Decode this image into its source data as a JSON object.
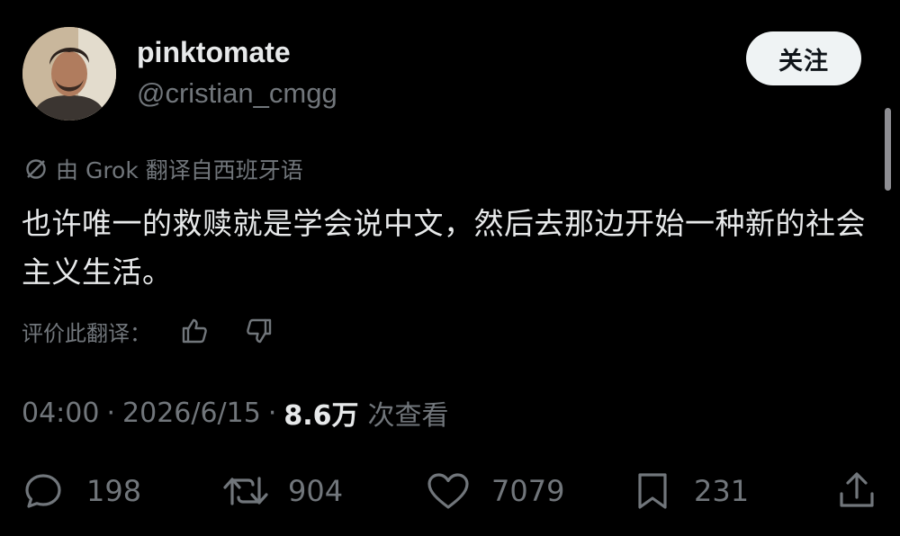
{
  "author": {
    "display_name": "pinktomate",
    "handle": "@cristian_cmgg"
  },
  "follow_button": {
    "label": "关注"
  },
  "translation": {
    "note": "由 Grok 翻译自西班牙语",
    "rate_label": "评价此翻译："
  },
  "tweet": {
    "text": "也许唯一的救赎就是学会说中文，然后去那边开始一种新的社会主义生活。"
  },
  "meta": {
    "time": "04:00",
    "date": "2026/6/15",
    "separator": "·",
    "views_count": "8.6万",
    "views_label": "次查看"
  },
  "actions": {
    "replies": "198",
    "reposts": "904",
    "likes": "7079",
    "bookmarks": "231"
  },
  "icons": {
    "translate": "no-entry-translate-icon",
    "thumbs_up": "thumbs-up-icon",
    "thumbs_down": "thumbs-down-icon",
    "reply": "reply-icon",
    "repost": "repost-icon",
    "like": "heart-icon",
    "bookmark": "bookmark-icon",
    "share": "share-icon"
  },
  "colors": {
    "background": "#000000",
    "primary_text": "#e7e9ea",
    "secondary_text": "#71767b",
    "follow_button_bg": "#eff3f4"
  }
}
